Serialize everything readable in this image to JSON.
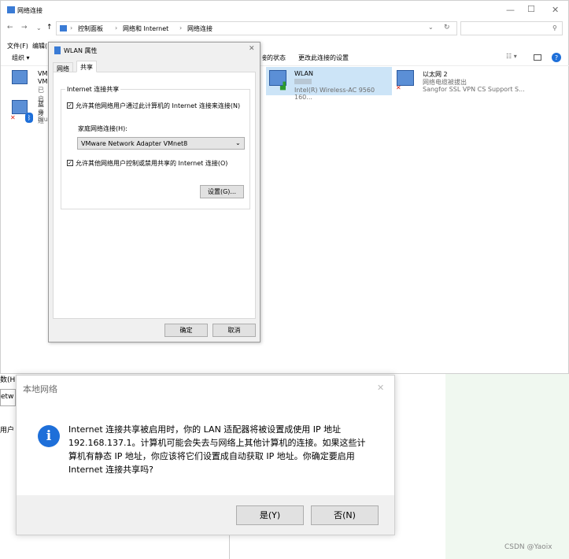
{
  "explorer": {
    "title": "网络连接",
    "controls": {
      "minimize": "—",
      "maximize": "☐",
      "close": "✕"
    },
    "breadcrumb": [
      "控制面板",
      "网络和 Internet",
      "网络连接"
    ],
    "menu": [
      "文件(F)",
      "编辑(E)"
    ],
    "commands": {
      "organize": "组织 ▾",
      "status": "此连接的状态",
      "change": "更改此连接的设置"
    },
    "adapters": [
      {
        "name": "VM",
        "line2": "VM",
        "line3": "已启"
      },
      {
        "name": "蓝牙",
        "line2": "未连",
        "line3": "Blue"
      },
      {
        "name": "WLAN",
        "line2": "",
        "line3": "Intel(R) Wireless-AC 9560 160..."
      },
      {
        "name": "以太网 2",
        "line2": "网络电缆被拔出",
        "line3": "Sangfor SSL VPN CS Support S..."
      }
    ]
  },
  "props": {
    "title": "WLAN 属性",
    "tabs": [
      "网络",
      "共享"
    ],
    "group_title": "Internet 连接共享",
    "allow_share": "允许其他网络用户通过此计算机的 Internet 连接来连接(N)",
    "home_label": "家庭网络连接(H):",
    "home_value": "VMware Network Adapter VMnet8",
    "allow_control": "允许其他网络用户控制或禁用共享的 Internet 连接(O)",
    "settings_button": "设置(G)...",
    "ok_button": "确定",
    "cancel_button": "取消"
  },
  "message": {
    "title": "本地网络",
    "text": "Internet 连接共享被启用时，你的 LAN 适配器将被设置成使用 IP 地址 192.168.137.1。计算机可能会失去与网络上其他计算机的连接。如果这些计算机有静态 IP 地址，你应该将它们设置成自动获取 IP 地址。你确定要启用 Internet 连接共享吗?",
    "yes_button": "是(Y)",
    "no_button": "否(N)"
  },
  "background_fragments": {
    "left1": "数(H)",
    "left2": "etw",
    "left3": "用户"
  },
  "watermark": "CSDN @Yaoix"
}
